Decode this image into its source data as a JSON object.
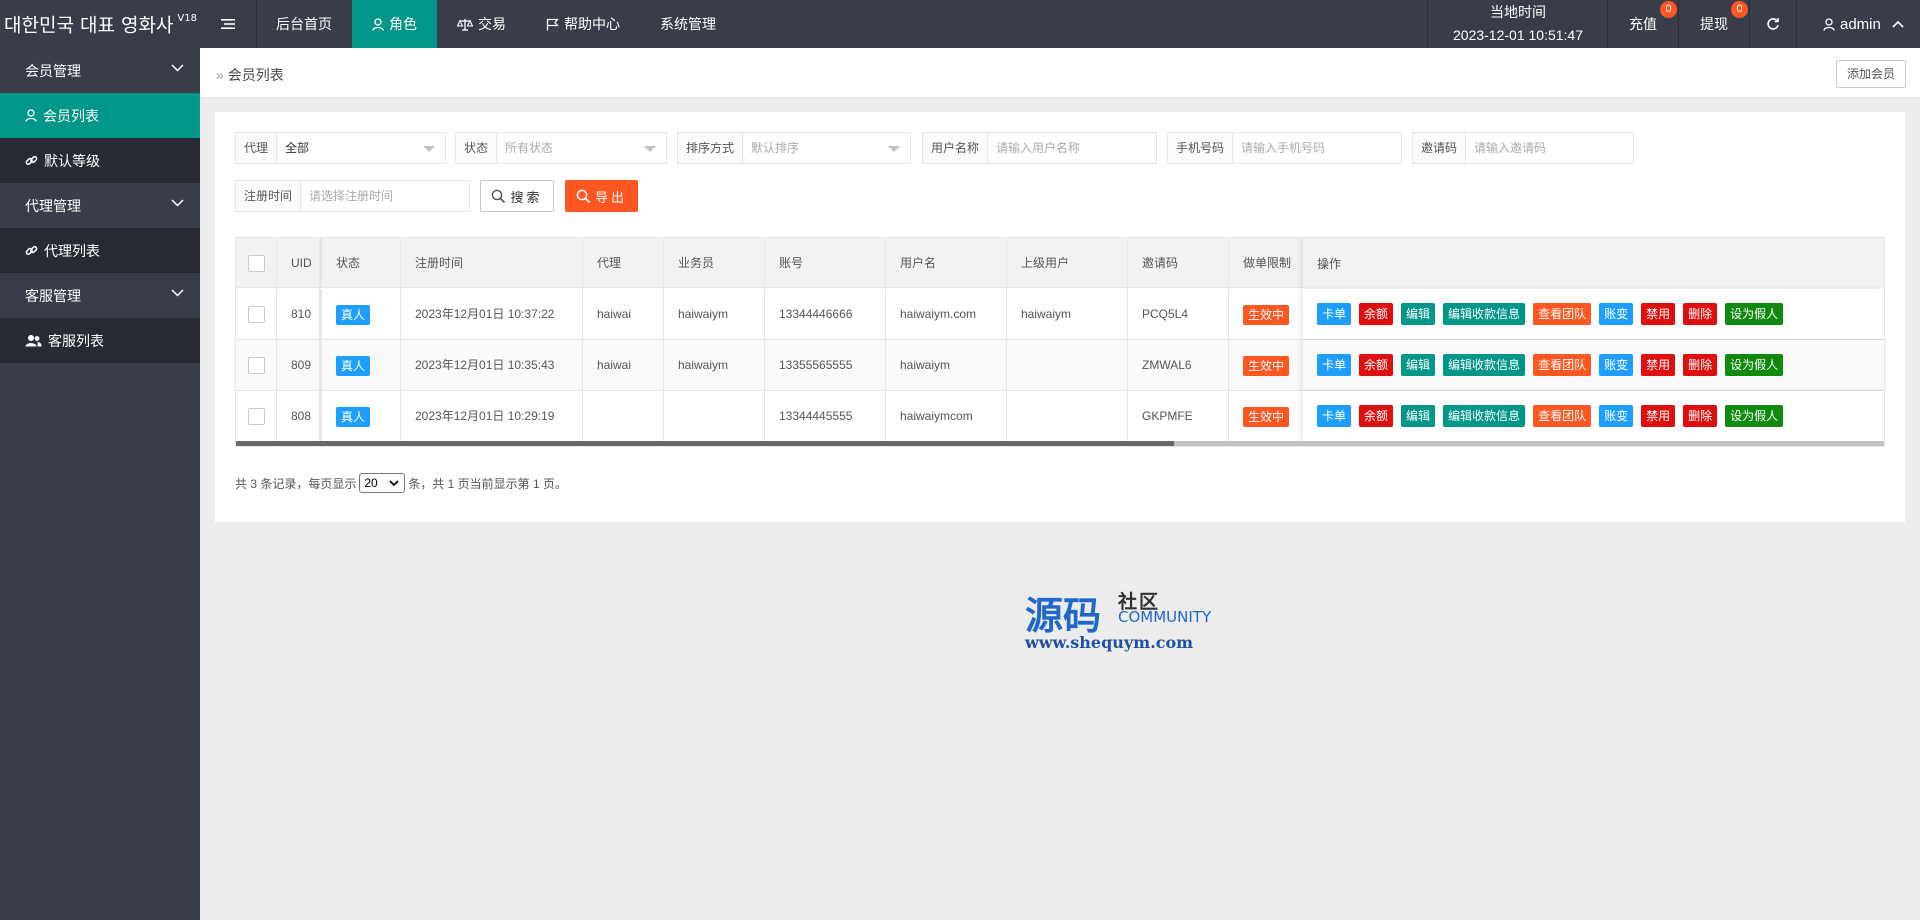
{
  "app": {
    "title": "대한민국 대표 영화사",
    "version": "V18"
  },
  "topnav": {
    "items": [
      {
        "label": "后台首页",
        "icon": "none"
      },
      {
        "label": "角色",
        "icon": "user-icon"
      },
      {
        "label": "交易",
        "icon": "scale-icon"
      },
      {
        "label": "帮助中心",
        "icon": "flag-icon"
      },
      {
        "label": "系统管理",
        "icon": "none"
      }
    ],
    "active_index": 1
  },
  "header": {
    "time_label": "当地时间",
    "time_value": "2023-12-01 10:51:47",
    "recharge_label": "充值",
    "recharge_badge": "0",
    "withdraw_label": "提现",
    "withdraw_badge": "0",
    "user_label": "admin"
  },
  "sidebar": {
    "groups": [
      {
        "label": "会员管理",
        "items": [
          {
            "label": "会员列表",
            "icon": "user-icon",
            "active": true
          },
          {
            "label": "默认等级",
            "icon": "link-icon"
          }
        ]
      },
      {
        "label": "代理管理",
        "items": [
          {
            "label": "代理列表",
            "icon": "link-icon"
          }
        ]
      },
      {
        "label": "客服管理",
        "items": [
          {
            "label": "客服列表",
            "icon": "users-icon"
          }
        ]
      }
    ]
  },
  "breadcrumb": {
    "label": "会员列表"
  },
  "add_member_label": "添加会员",
  "filters": {
    "agent": {
      "label": "代理",
      "value": "全部"
    },
    "status": {
      "label": "状态",
      "placeholder": "所有状态"
    },
    "sort": {
      "label": "排序方式",
      "placeholder": "默认排序"
    },
    "username": {
      "label": "用户名称",
      "placeholder": "请输入用户名称"
    },
    "phone": {
      "label": "手机号码",
      "placeholder": "请输入手机号码"
    },
    "invite": {
      "label": "邀请码",
      "placeholder": "请输入邀请码"
    },
    "regtime": {
      "label": "注册时间",
      "placeholder": "请选择注册时间"
    },
    "search_label": "搜索",
    "export_label": "导出"
  },
  "table": {
    "headers": {
      "uid": "UID",
      "status": "状态",
      "regtime": "注册时间",
      "agent": "代理",
      "salesman": "业务员",
      "account": "账号",
      "username": "用户名",
      "parent": "上级用户",
      "invite": "邀请码",
      "limit": "做单限制",
      "ops": "操作"
    },
    "rows": [
      {
        "uid": "810",
        "status": "真人",
        "regtime": "2023年12月01日 10:37:22",
        "agent": "haiwai",
        "salesman": "haiwaiym",
        "account": "13344446666",
        "username": "haiwaiym.com",
        "parent": "haiwaiym",
        "invite": "PCQ5L4",
        "limit": "生效中"
      },
      {
        "uid": "809",
        "status": "真人",
        "regtime": "2023年12月01日 10:35:43",
        "agent": "haiwai",
        "salesman": "haiwaiym",
        "account": "13355565555",
        "username": "haiwaiym",
        "parent": "",
        "invite": "ZMWAL6",
        "limit": "生效中"
      },
      {
        "uid": "808",
        "status": "真人",
        "regtime": "2023年12月01日 10:29:19",
        "agent": "",
        "salesman": "",
        "account": "13344445555",
        "username": "haiwaiymcom",
        "parent": "",
        "invite": "GKPMFE",
        "limit": "生效中"
      }
    ],
    "ops": [
      {
        "label": "卡单",
        "color": "#1e9fff"
      },
      {
        "label": "余额",
        "color": "#e00f0f"
      },
      {
        "label": "编辑",
        "color": "#009688"
      },
      {
        "label": "编辑收款信息",
        "color": "#009688"
      },
      {
        "label": "查看团队",
        "color": "#ff5722"
      },
      {
        "label": "账变",
        "color": "#1e9fff"
      },
      {
        "label": "禁用",
        "color": "#e00f0f"
      },
      {
        "label": "删除",
        "color": "#e00f0f"
      },
      {
        "label": "设为假人",
        "color": "#0f8a0f"
      }
    ]
  },
  "pager": {
    "prefix": "共 3 条记录，每页显示",
    "page_size": "20",
    "suffix": "条，共 1 页当前显示第 1 页。"
  },
  "watermark": {
    "big": "源码",
    "small": "社区",
    "community": "COMMUNITY",
    "url": "www.shequym.com"
  },
  "colors": {
    "header_bg": "#393d49",
    "accent": "#009688",
    "danger": "#ff5722",
    "info": "#1e9fff"
  }
}
